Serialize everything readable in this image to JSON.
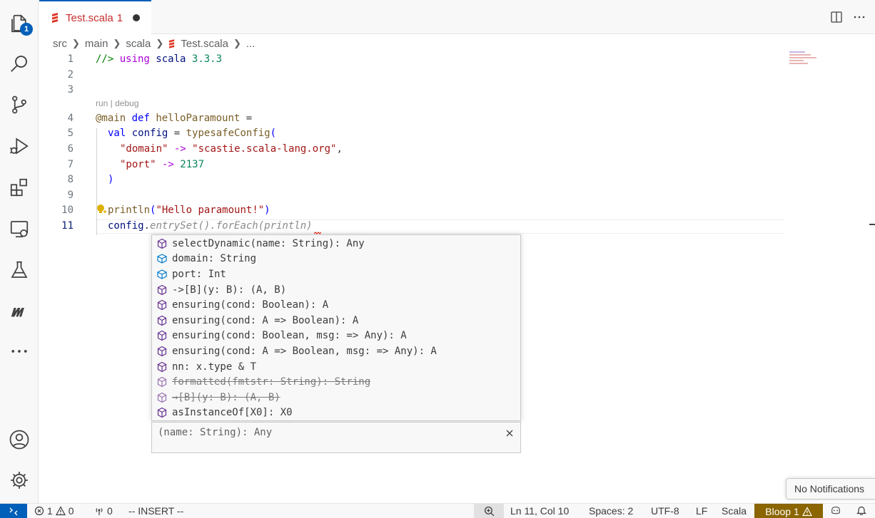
{
  "tab": {
    "filename": "Test.scala",
    "problem_count": "1"
  },
  "breadcrumb": {
    "items": [
      "src",
      "main",
      "scala",
      "Test.scala",
      "..."
    ]
  },
  "code_lens": "run | debug",
  "editor": {
    "line_numbers": [
      "1",
      "2",
      "3",
      "4",
      "5",
      "6",
      "7",
      "8",
      "9",
      "10",
      "11"
    ],
    "lines": {
      "l1_prefix": "//> ",
      "l1_using": "using",
      "l1_scala": " scala ",
      "l1_version": "3.3.3",
      "l4_ann": "@main",
      "l4_def": " def ",
      "l4_name": "helloParamount",
      "l4_eq": " =",
      "l5_val": "val",
      "l5_config": " config",
      "l5_eq": " = ",
      "l5_func": "typesafeConfig",
      "l5_paren": "(",
      "l6_key": "\"domain\"",
      "l6_arrow": " -> ",
      "l6_value": "\"scastie.scala-lang.org\"",
      "l6_comma": ",",
      "l7_key": "\"port\"",
      "l7_arrow": " -> ",
      "l7_value": "2137",
      "l8_close": ")",
      "l10_func": "println",
      "l10_open": "(",
      "l10_str": "\"Hello paramount!\"",
      "l10_close": ")",
      "l11_var": "config",
      "l11_dot": ".",
      "l11_ghost": "entrySet().forEach(println)"
    }
  },
  "suggestions": [
    {
      "label": "selectDynamic(name: String): Any",
      "icon": "method-icon",
      "deprecated": false
    },
    {
      "label": "domain: String",
      "icon": "field-icon",
      "deprecated": false
    },
    {
      "label": "port: Int",
      "icon": "field-icon",
      "deprecated": false
    },
    {
      "label": "->[B](y: B): (A, B)",
      "icon": "method-icon",
      "deprecated": false
    },
    {
      "label": "ensuring(cond: Boolean): A",
      "icon": "method-icon",
      "deprecated": false
    },
    {
      "label": "ensuring(cond: A => Boolean): A",
      "icon": "method-icon",
      "deprecated": false
    },
    {
      "label": "ensuring(cond: Boolean, msg: => Any): A",
      "icon": "method-icon",
      "deprecated": false
    },
    {
      "label": "ensuring(cond: A => Boolean, msg: => Any): A",
      "icon": "method-icon",
      "deprecated": false
    },
    {
      "label": "nn: x.type & T",
      "icon": "method-icon",
      "deprecated": false
    },
    {
      "label": "formatted(fmtstr: String): String",
      "icon": "method-icon",
      "deprecated": true
    },
    {
      "label": "→[B](y: B): (A, B)",
      "icon": "method-icon",
      "deprecated": true
    },
    {
      "label": "asInstanceOf[X0]: X0",
      "icon": "method-icon",
      "deprecated": false
    }
  ],
  "details": {
    "signature": "(name: String): Any"
  },
  "notification": "No Notifications",
  "activity": {
    "explorer_badge": "1"
  },
  "status": {
    "errors": "1",
    "warnings": "0",
    "ports": "0",
    "mode": "-- INSERT --",
    "position": "Ln 11, Col 10",
    "spaces": "Spaces: 2",
    "encoding": "UTF-8",
    "eol": "LF",
    "language": "Scala",
    "bloop": "Bloop 1"
  },
  "colors": {
    "accent": "#005fb8",
    "tab_title": "#c72e2e",
    "bloop_bg": "#8a6500",
    "method_icon": "#652d90",
    "field_icon": "#007acc"
  }
}
